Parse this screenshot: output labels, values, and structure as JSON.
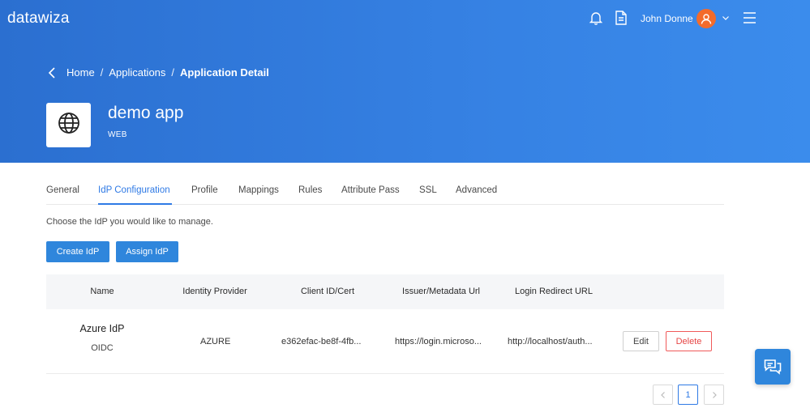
{
  "header": {
    "logo": "datawiza",
    "user_name": "John Donne"
  },
  "breadcrumb": {
    "home": "Home",
    "applications": "Applications",
    "current": "Application Detail",
    "separator": "/"
  },
  "app": {
    "name": "demo app",
    "type": "WEB",
    "icon": "globe-icon"
  },
  "tabs": [
    {
      "label": "General"
    },
    {
      "label": "IdP Configuration",
      "active": true
    },
    {
      "label": "Profile"
    },
    {
      "label": "Mappings"
    },
    {
      "label": "Rules"
    },
    {
      "label": "Attribute Pass"
    },
    {
      "label": "SSL"
    },
    {
      "label": "Advanced"
    }
  ],
  "hint": "Choose the IdP you would like to manage.",
  "actions": {
    "create": "Create IdP",
    "assign": "Assign IdP"
  },
  "table": {
    "columns": [
      "Name",
      "Identity Provider",
      "Client ID/Cert",
      "Issuer/Metadata Url",
      "Login Redirect URL"
    ],
    "rows": [
      {
        "name": "Azure IdP",
        "protocol": "OIDC",
        "provider": "AZURE",
        "client_id": "e362efac-be8f-4fb...",
        "issuer": "https://login.microso...",
        "redirect": "http://localhost/auth...",
        "edit_label": "Edit",
        "delete_label": "Delete"
      }
    ]
  },
  "pagination": {
    "prev": "<",
    "page": "1",
    "next": ">"
  },
  "colors": {
    "header_gradient_start": "#2b6fd0",
    "header_gradient_end": "#3b8cec",
    "accent": "#2f7ae5",
    "primary_button": "#2f86dc",
    "avatar": "#f36b2b",
    "danger": "#e64545"
  }
}
